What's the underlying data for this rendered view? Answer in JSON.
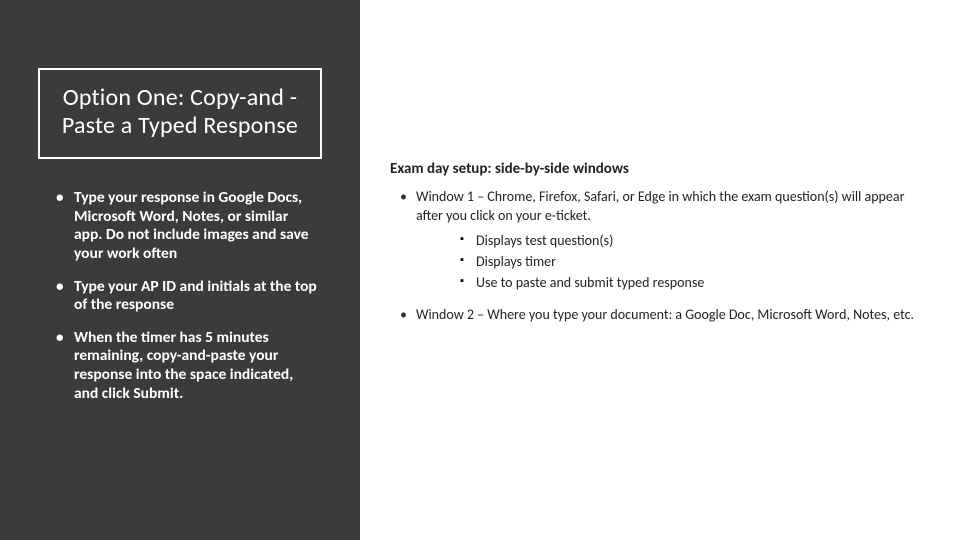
{
  "left": {
    "title": "Option One: Copy-and -Paste a Typed Response",
    "bullets": [
      "Type your response in Google Docs, Microsoft Word, Notes, or similar app. Do not include images and save your work often",
      "Type your AP ID and initials at the top of the response",
      "When the timer has 5 minutes remaining, copy-and-paste your response into the space indicated, and click Submit."
    ]
  },
  "right": {
    "subheading": "Exam day setup: side-by-side windows",
    "outer": [
      "Window 1 – Chrome, Firefox, Safari, or Edge in which the exam question(s) will appear after you click on your e-ticket.",
      "Window 2 – Where you type your document: a Google Doc, Microsoft Word, Notes, etc."
    ],
    "inner": [
      "Displays test question(s)",
      "Displays timer",
      "Use to paste and submit typed response"
    ]
  }
}
